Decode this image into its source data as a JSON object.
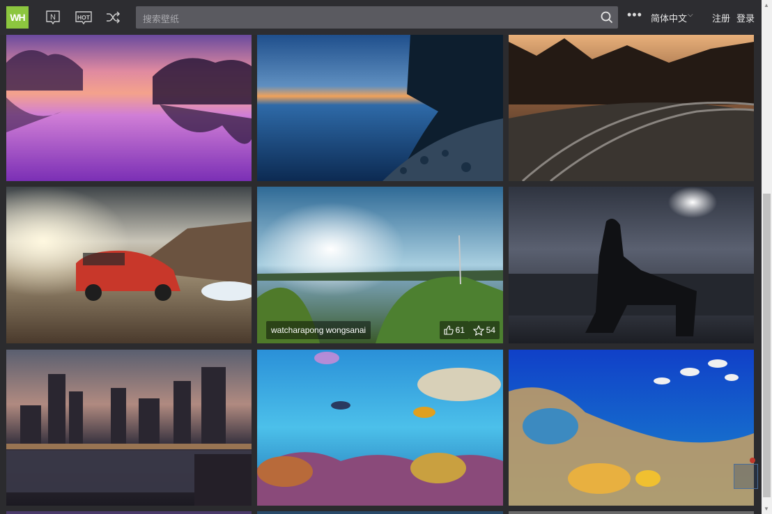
{
  "header": {
    "logo_text": "WH",
    "search_placeholder": "搜索壁纸",
    "language": "简体中文",
    "register": "注册",
    "login": "登录",
    "icons": [
      "new-icon",
      "hot-icon",
      "shuffle-icon",
      "search-icon",
      "more-icon"
    ]
  },
  "grid": {
    "tiles": [
      {
        "name": "sunset-lake"
      },
      {
        "name": "blue-shore"
      },
      {
        "name": "railway-forest"
      },
      {
        "name": "red-car"
      },
      {
        "name": "green-lake",
        "author": "watcharapong wongsanai",
        "likes": "61",
        "favorites": "54"
      },
      {
        "name": "dark-woman"
      },
      {
        "name": "city-night"
      },
      {
        "name": "underwater-pufferfish"
      },
      {
        "name": "coral-reef-fish"
      }
    ]
  },
  "colors": {
    "accent": "#8cc63f",
    "topbar": "#2d2d31",
    "search": "#5a5a60"
  }
}
